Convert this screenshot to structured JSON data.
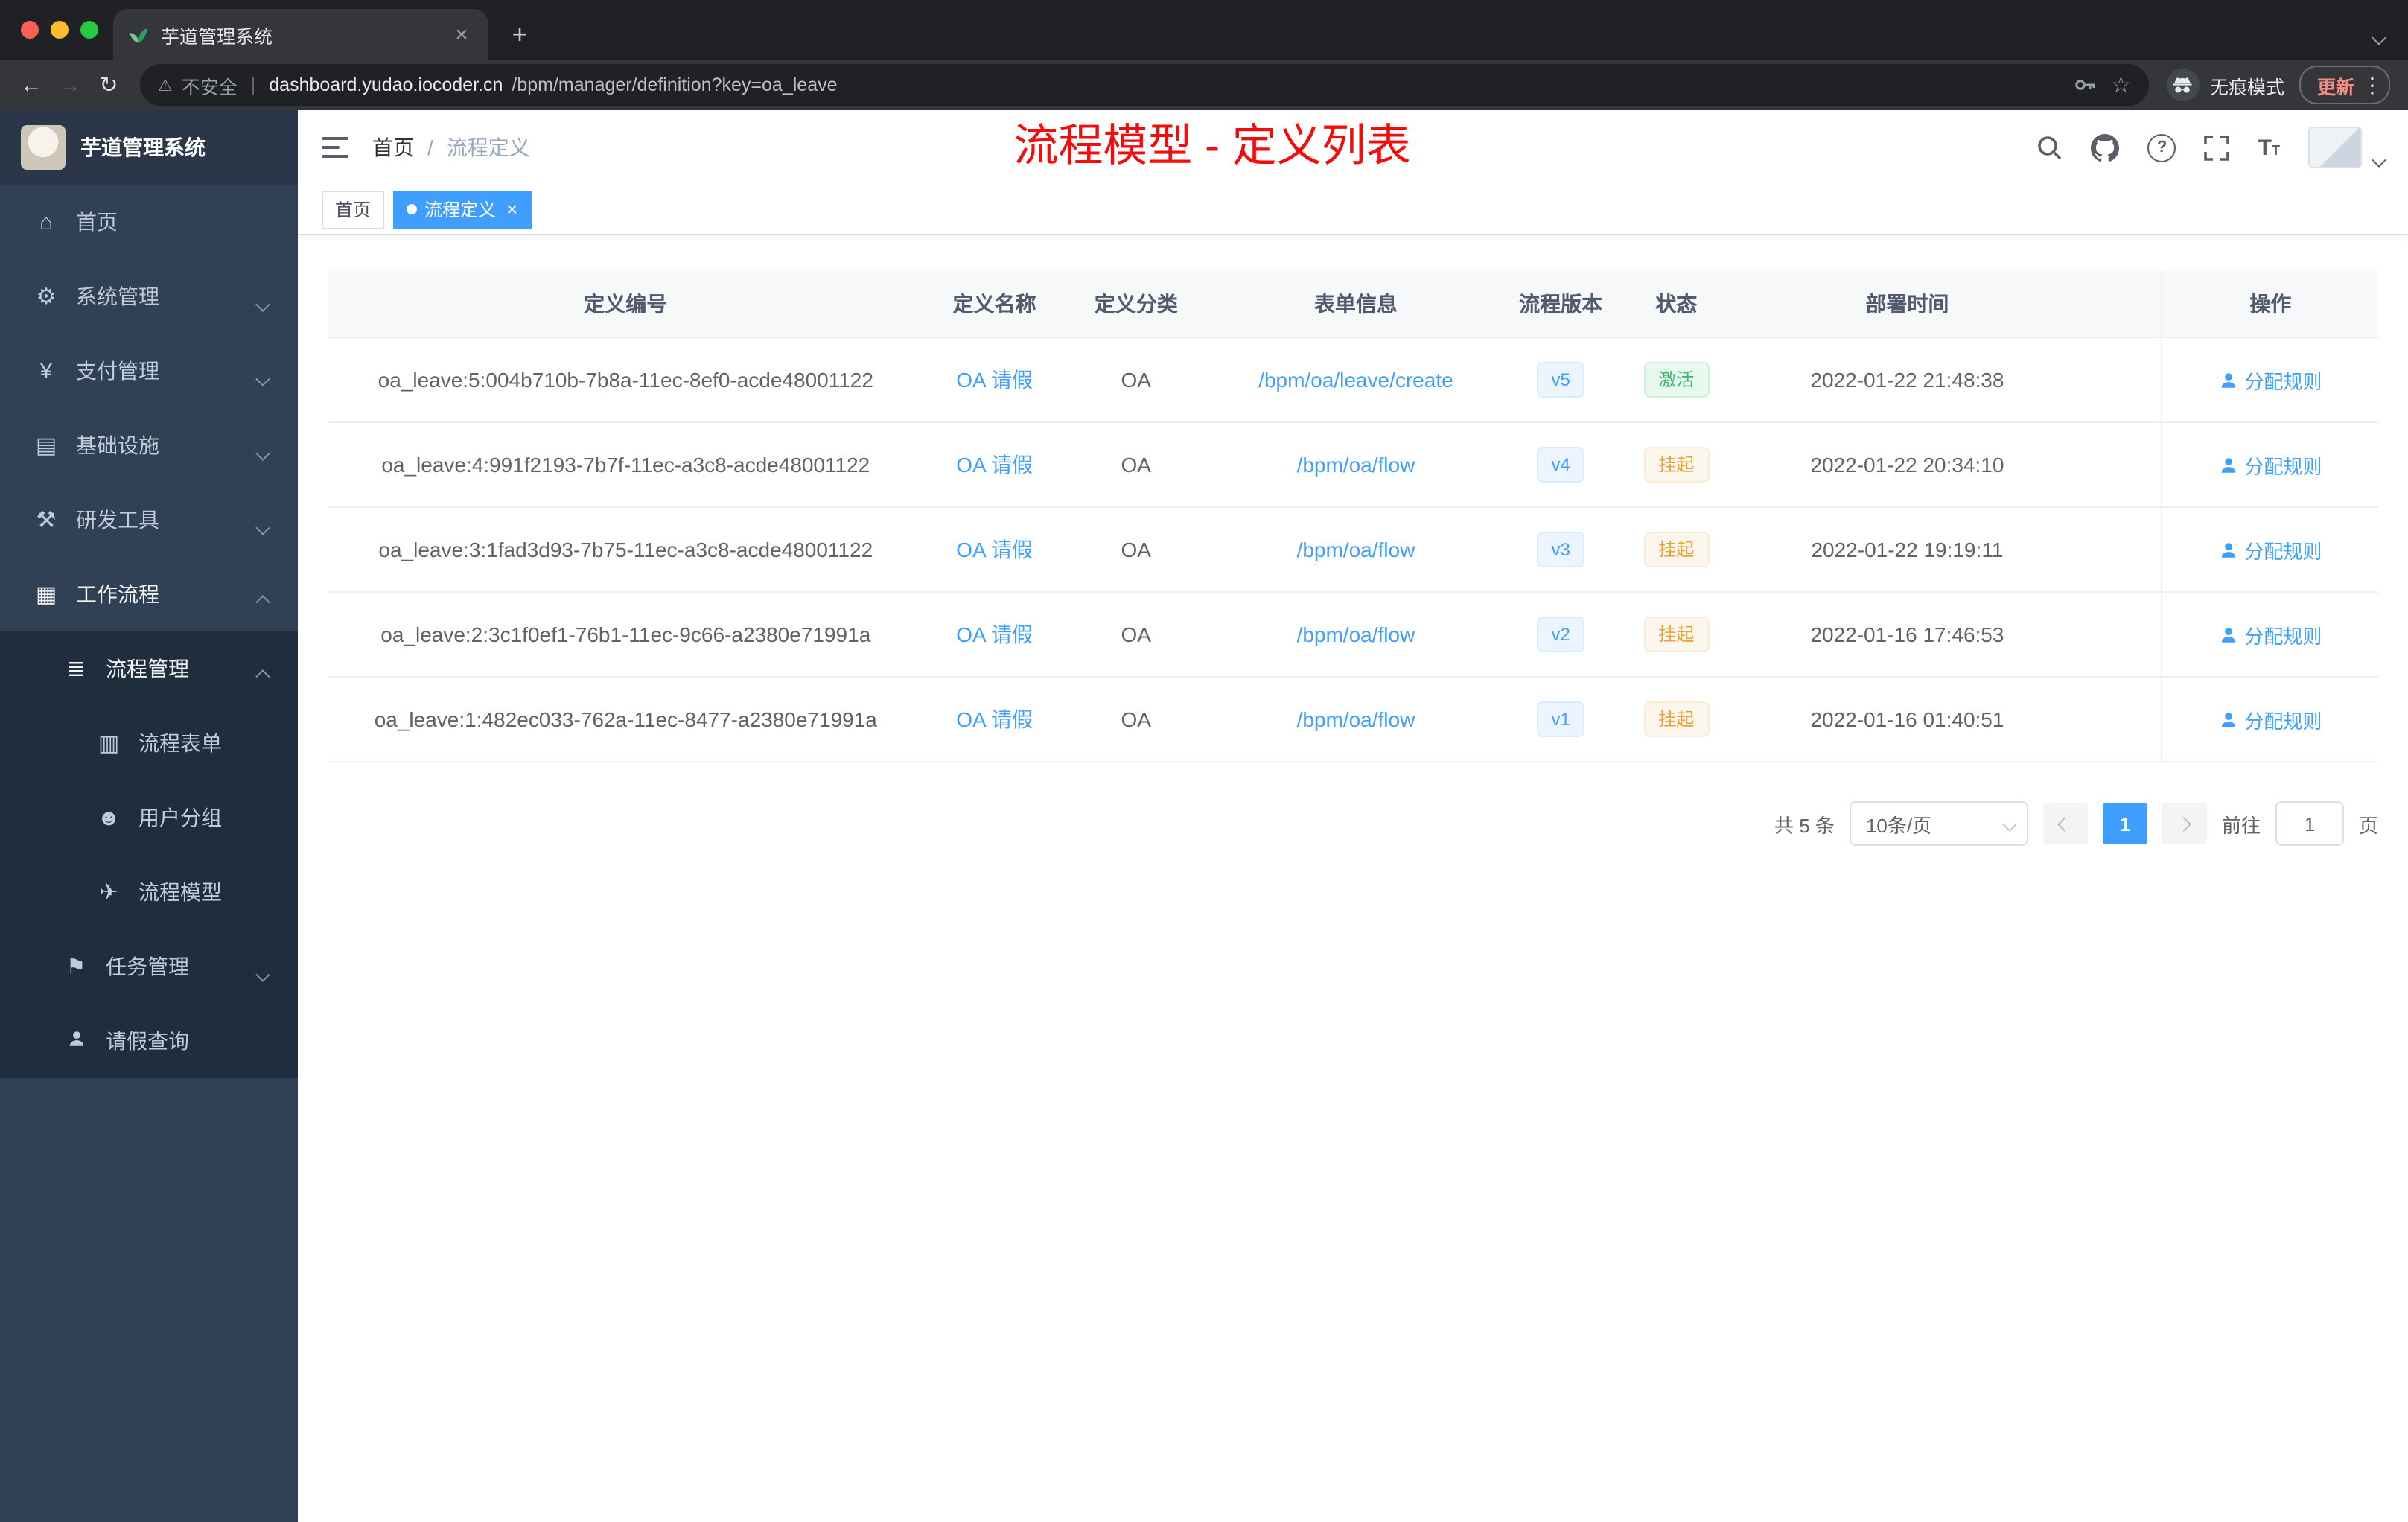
{
  "colors": {
    "accent": "#409eff",
    "success_text": "#3cba6c",
    "warning_text": "#e6a23c",
    "annotation_red": "#f40b0b",
    "sidebar_bg": "#304156",
    "sidebar_submenu_bg": "#1f2d3d"
  },
  "browser": {
    "tab_title": "芋道管理系统",
    "security_label": "不安全",
    "url_host": "dashboard.yudao.iocoder.cn",
    "url_path": "/bpm/manager/definition?key=oa_leave",
    "incognito_label": "无痕模式",
    "update_label": "更新"
  },
  "icons": {
    "back": "←",
    "forward": "→",
    "reload": "↻",
    "warning": "⚠",
    "star": "☆",
    "more": "⋮",
    "close": "×",
    "new_tab": "+",
    "home": "⌂",
    "system": "⚙",
    "payment": "¥",
    "infra": "▤",
    "devtools": "⚒",
    "workflow": "▦",
    "process_mgmt": "≣",
    "process_form": "▥",
    "user_group": "☻",
    "process_model": "✈",
    "task_mgmt": "⚑",
    "question": "?",
    "font_large": "T",
    "font_small": "T"
  },
  "sidebar": {
    "logo_title": "芋道管理系统",
    "items": [
      {
        "label": "首页"
      },
      {
        "label": "系统管理"
      },
      {
        "label": "支付管理"
      },
      {
        "label": "基础设施"
      },
      {
        "label": "研发工具"
      },
      {
        "label": "工作流程"
      },
      {
        "label": "流程管理"
      },
      {
        "label": "流程表单"
      },
      {
        "label": "用户分组"
      },
      {
        "label": "流程模型"
      },
      {
        "label": "任务管理"
      },
      {
        "label": "请假查询"
      }
    ]
  },
  "header": {
    "breadcrumb": {
      "home": "首页",
      "separator": "/",
      "current": "流程定义"
    },
    "annotation": "流程模型 - 定义列表"
  },
  "tags": {
    "home": "首页",
    "active": "流程定义"
  },
  "table": {
    "columns": [
      "定义编号",
      "定义名称",
      "定义分类",
      "表单信息",
      "流程版本",
      "状态",
      "部署时间",
      "操作"
    ],
    "rows": [
      {
        "id": "oa_leave:5:004b710b-7b8a-11ec-8ef0-acde48001122",
        "name": "OA 请假",
        "category": "OA",
        "form": "/bpm/oa/leave/create",
        "version": "v5",
        "status": "激活",
        "status_type": "success",
        "deployed": "2022-01-22 21:48:38",
        "action": "分配规则"
      },
      {
        "id": "oa_leave:4:991f2193-7b7f-11ec-a3c8-acde48001122",
        "name": "OA 请假",
        "category": "OA",
        "form": "/bpm/oa/flow",
        "version": "v4",
        "status": "挂起",
        "status_type": "warning",
        "deployed": "2022-01-22 20:34:10",
        "action": "分配规则"
      },
      {
        "id": "oa_leave:3:1fad3d93-7b75-11ec-a3c8-acde48001122",
        "name": "OA 请假",
        "category": "OA",
        "form": "/bpm/oa/flow",
        "version": "v3",
        "status": "挂起",
        "status_type": "warning",
        "deployed": "2022-01-22 19:19:11",
        "action": "分配规则"
      },
      {
        "id": "oa_leave:2:3c1f0ef1-76b1-11ec-9c66-a2380e71991a",
        "name": "OA 请假",
        "category": "OA",
        "form": "/bpm/oa/flow",
        "version": "v2",
        "status": "挂起",
        "status_type": "warning",
        "deployed": "2022-01-16 17:46:53",
        "action": "分配规则"
      },
      {
        "id": "oa_leave:1:482ec033-762a-11ec-8477-a2380e71991a",
        "name": "OA 请假",
        "category": "OA",
        "form": "/bpm/oa/flow",
        "version": "v1",
        "status": "挂起",
        "status_type": "warning",
        "deployed": "2022-01-16 01:40:51",
        "action": "分配规则"
      }
    ]
  },
  "pagination": {
    "total": "共 5 条",
    "page_size": "10条/页",
    "current_page": "1",
    "goto_label": "前往",
    "goto_value": "1",
    "goto_unit": "页"
  }
}
